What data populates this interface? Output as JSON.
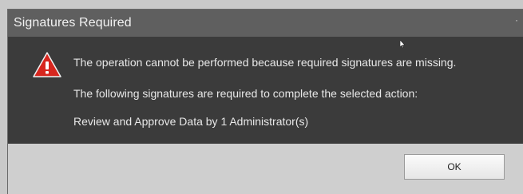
{
  "dialog": {
    "title": "Signatures Required",
    "close_glyph": "·",
    "icon": "warning-icon",
    "messages": {
      "line1": "The operation cannot be performed because required signatures are missing.",
      "line2": "The following signatures are required to complete the selected action:",
      "line3": "Review and Approve Data by 1 Administrator(s)"
    },
    "ok_label": "OK"
  },
  "colors": {
    "title_bar": "#5f5f5f",
    "content_bg": "#3b3b3b",
    "footer_bg": "#cfcfcf",
    "warning_red": "#d7261e"
  }
}
